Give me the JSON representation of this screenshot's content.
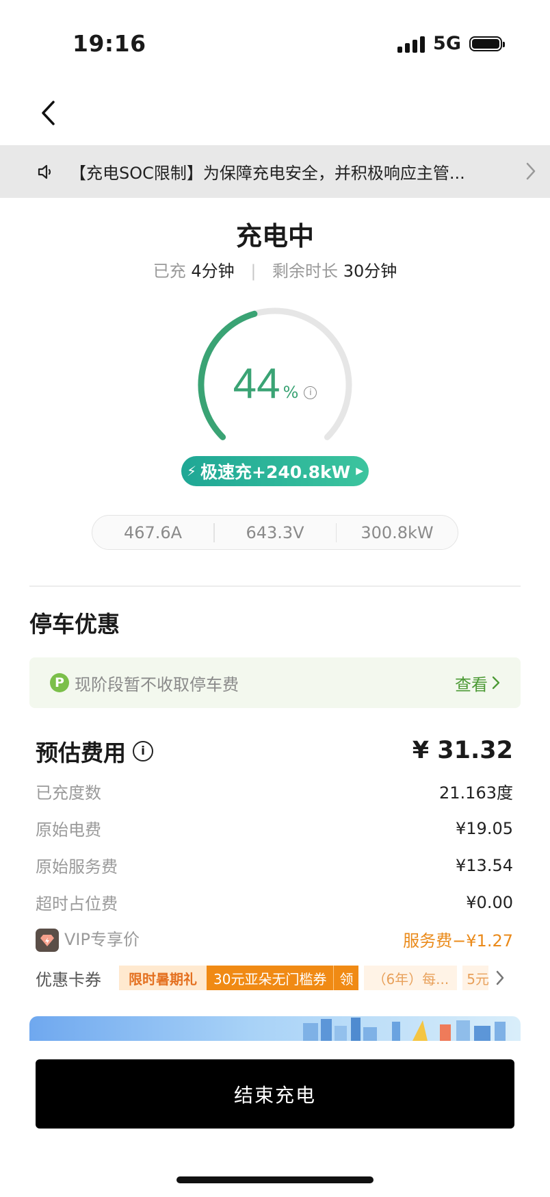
{
  "status_bar": {
    "time": "19:16",
    "network": "5G"
  },
  "notice": {
    "text": "【充电SOC限制】为保障充电安全，并积极响应主管..."
  },
  "charging": {
    "status": "充电中",
    "charged_label": "已充",
    "charged_value": "4分钟",
    "remaining_label": "剩余时长",
    "remaining_value": "30分钟",
    "percent": "44",
    "percent_sign": "%",
    "progress_fraction": 0.44,
    "fast_label": "极速充+240.8kW"
  },
  "metrics": {
    "current": "467.6A",
    "voltage": "643.3V",
    "power": "300.8kW"
  },
  "parking": {
    "title": "停车优惠",
    "badge": "P",
    "text": "现阶段暂不收取停车费",
    "link": "查看"
  },
  "fees": {
    "title": "预估费用",
    "total": "¥ 31.32",
    "rows": [
      {
        "label": "已充度数",
        "value": "21.163度"
      },
      {
        "label": "原始电费",
        "value": "¥19.05"
      },
      {
        "label": "原始服务费",
        "value": "¥13.54"
      },
      {
        "label": "超时占位费",
        "value": "¥0.00"
      }
    ],
    "vip": {
      "label": "VIP专享价",
      "value": "服务费−¥1.27"
    }
  },
  "coupons": {
    "label": "优惠卡券",
    "promo": "限时暑期礼",
    "coupon": "30元亚朵无门槛券",
    "claim": "领",
    "item2": "（6年）每...",
    "item3": "5元"
  },
  "end_button": "结束充电",
  "colors": {
    "accent_green": "#3aa374",
    "fast_gradient": "#1fa795",
    "vip_orange": "#ea8a1a",
    "coupon_orange": "#f08a14"
  }
}
